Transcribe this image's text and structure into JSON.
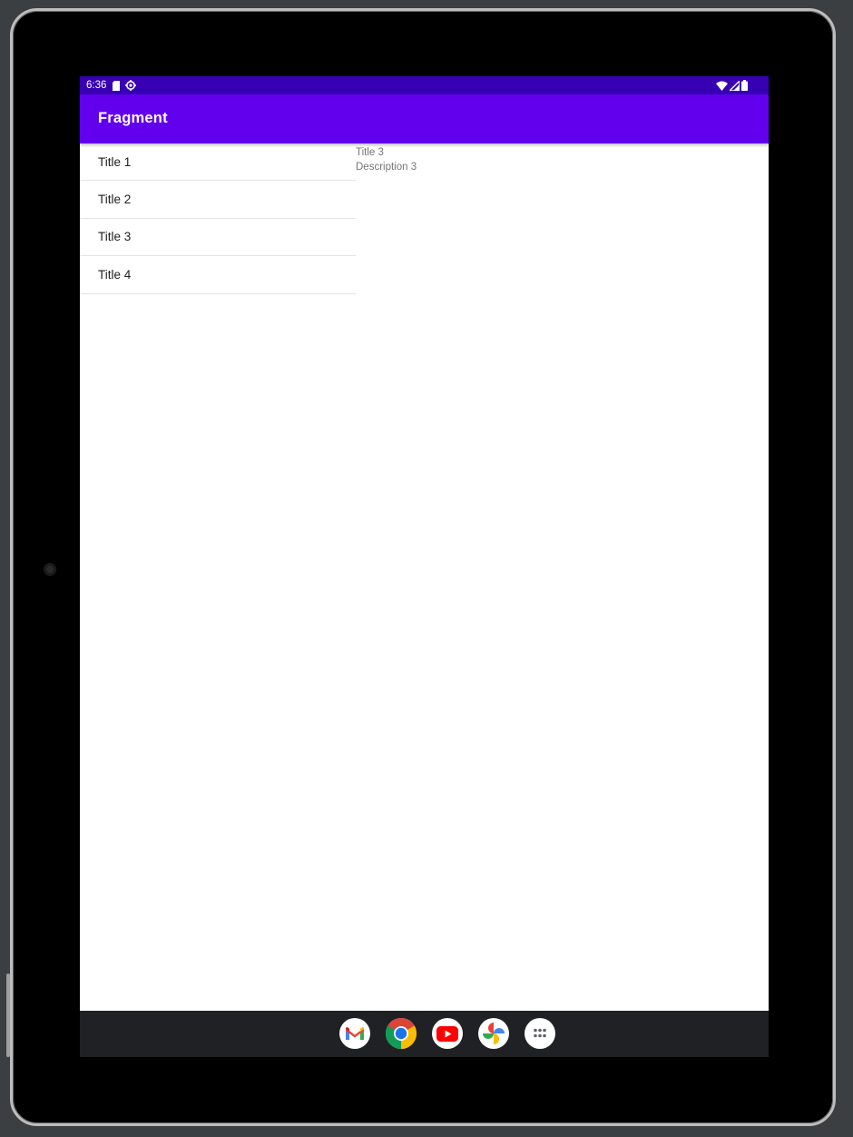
{
  "status_bar": {
    "time": "6:36",
    "icons": [
      "sd-card-icon",
      "settings-gear-icon",
      "wifi-icon",
      "cellular-signal-icon",
      "battery-icon"
    ]
  },
  "app_bar": {
    "title": "Fragment"
  },
  "list": {
    "items": [
      {
        "label": "Title 1"
      },
      {
        "label": "Title 2"
      },
      {
        "label": "Title 3"
      },
      {
        "label": "Title 4"
      }
    ]
  },
  "detail": {
    "title": "Title 3",
    "description": "Description 3"
  },
  "dock": {
    "apps": [
      "gmail-icon",
      "chrome-icon",
      "youtube-icon",
      "photos-icon",
      "app-drawer-icon"
    ]
  },
  "colors": {
    "status_bar": "#3700b3",
    "app_bar": "#6200ee",
    "nav_bar": "#202124",
    "device_frame": "#000000"
  }
}
